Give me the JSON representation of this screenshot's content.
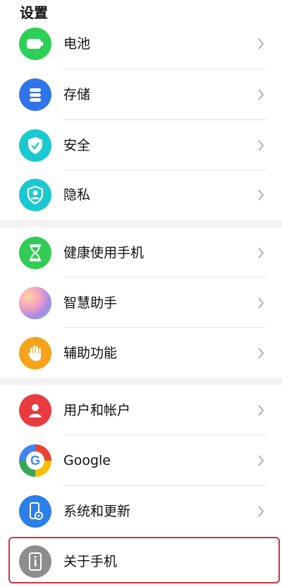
{
  "header": {
    "title": "设置"
  },
  "colors": {
    "battery": "#2ecf58",
    "storage": "#2f74e8",
    "security": "#1ac9cf",
    "privacy": "#1ac9cf",
    "health": "#32cb55",
    "assistant": "#a58be6",
    "accessibility": "#f6a21a",
    "users": "#e83a3f",
    "system": "#2c7ee8",
    "about": "#8d8d8d",
    "highlight": "#c8353f"
  },
  "items": [
    {
      "label": "电池",
      "icon": "battery-icon"
    },
    {
      "label": "存储",
      "icon": "storage-icon"
    },
    {
      "label": "安全",
      "icon": "shield-check-icon"
    },
    {
      "label": "隐私",
      "icon": "privacy-icon"
    },
    {
      "label": "健康使用手机",
      "icon": "hourglass-icon"
    },
    {
      "label": "智慧助手",
      "icon": "assistant-icon"
    },
    {
      "label": "辅助功能",
      "icon": "hand-icon"
    },
    {
      "label": "用户和帐户",
      "icon": "user-icon"
    },
    {
      "label": "Google",
      "icon": "google-icon"
    },
    {
      "label": "系统和更新",
      "icon": "system-update-icon"
    },
    {
      "label": "关于手机",
      "icon": "info-icon"
    }
  ]
}
